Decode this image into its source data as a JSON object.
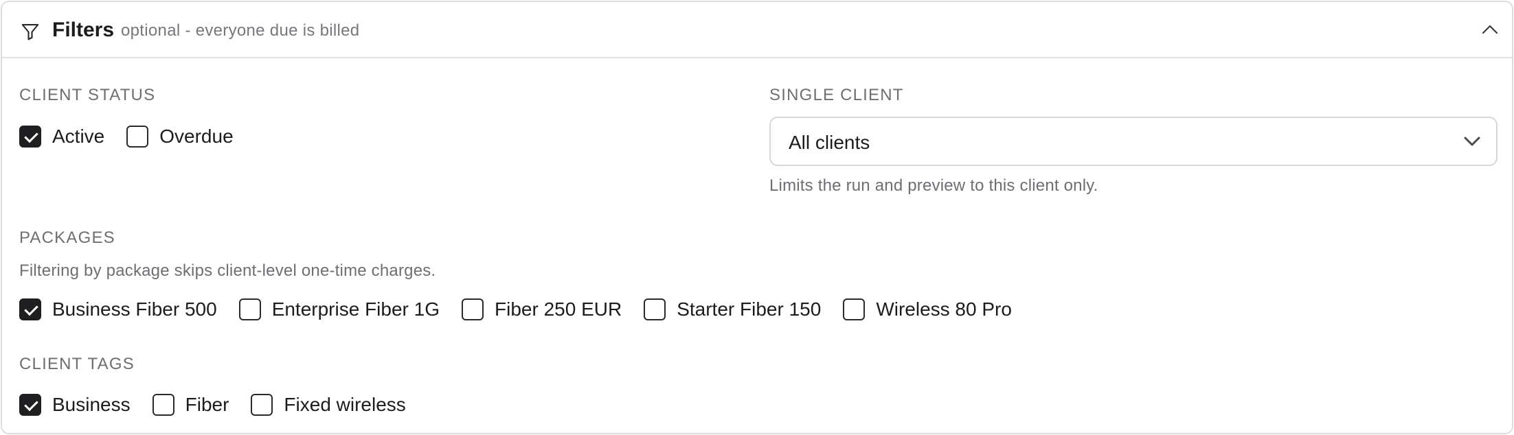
{
  "header": {
    "title": "Filters",
    "subtitle": "optional - everyone due is billed",
    "icon": "filter-icon",
    "collapse_icon": "chevron-up-icon"
  },
  "client_status": {
    "label": "CLIENT STATUS",
    "options": [
      {
        "label": "Active",
        "checked": true
      },
      {
        "label": "Overdue",
        "checked": false
      }
    ]
  },
  "single_client": {
    "label": "SINGLE CLIENT",
    "selected": "All clients",
    "help": "Limits the run and preview to this client only."
  },
  "packages": {
    "label": "PACKAGES",
    "help": "Filtering by package skips client-level one-time charges.",
    "options": [
      {
        "label": "Business Fiber 500",
        "checked": true
      },
      {
        "label": "Enterprise Fiber 1G",
        "checked": false
      },
      {
        "label": "Fiber 250 EUR",
        "checked": false
      },
      {
        "label": "Starter Fiber 150",
        "checked": false
      },
      {
        "label": "Wireless 80 Pro",
        "checked": false
      }
    ]
  },
  "client_tags": {
    "label": "CLIENT TAGS",
    "options": [
      {
        "label": "Business",
        "checked": true
      },
      {
        "label": "Fiber",
        "checked": false
      },
      {
        "label": "Fixed wireless",
        "checked": false
      }
    ]
  },
  "colors": {
    "checkbox_checked": "#1f1f21",
    "border": "#dcdcde",
    "muted_text": "#6e6e73"
  }
}
